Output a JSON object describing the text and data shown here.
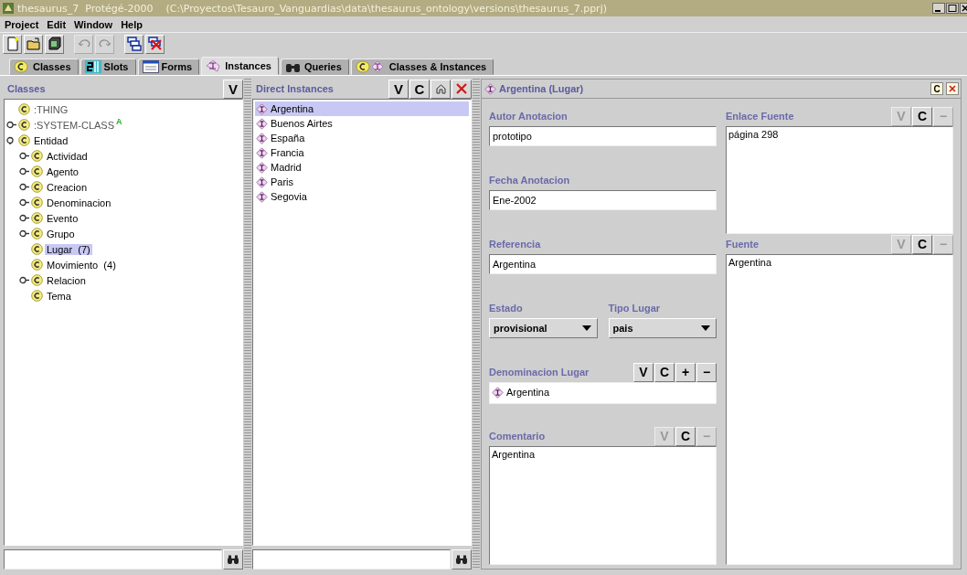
{
  "window": {
    "title": "thesaurus_7  Protégé-2000    (C:\\Proyectos\\Tesauro_Vanguardias\\data\\thesaurus_ontology\\versions\\thesaurus_7.pprj)"
  },
  "menu": [
    "Project",
    "Edit",
    "Window",
    "Help"
  ],
  "toolbar": [
    {
      "disabled": false
    },
    {
      "disabled": false
    },
    {
      "disabled": false
    },
    {
      "disabled": true
    },
    {
      "disabled": true
    },
    {
      "disabled": false
    },
    {
      "disabled": false
    }
  ],
  "tabs": [
    {
      "label": "Classes",
      "selected": false
    },
    {
      "label": "Slots",
      "selected": false
    },
    {
      "label": "Forms",
      "selected": false
    },
    {
      "label": "Instances",
      "selected": true
    },
    {
      "label": "Queries",
      "selected": false
    },
    {
      "label": "Classes & Instances",
      "selected": false
    }
  ],
  "classes": {
    "title": "Classes",
    "buttons": [
      "V"
    ],
    "tree": [
      {
        "label": ":THING",
        "kind": "leaf",
        "system": true,
        "selected": false
      },
      {
        "label": ":SYSTEM-CLASS",
        "kind": "branch",
        "expanded": false,
        "system": true,
        "badge": "A",
        "selected": false
      },
      {
        "label": "Entidad",
        "kind": "branch",
        "expanded": true,
        "system": false,
        "selected": false,
        "children": [
          {
            "label": "Actividad",
            "kind": "branch",
            "expanded": false,
            "system": false,
            "selected": false
          },
          {
            "label": "Agento",
            "kind": "branch",
            "expanded": false,
            "system": false,
            "selected": false
          },
          {
            "label": "Creacion",
            "kind": "branch",
            "expanded": false,
            "system": false,
            "selected": false
          },
          {
            "label": "Denominacion",
            "kind": "branch",
            "expanded": false,
            "system": false,
            "selected": false
          },
          {
            "label": "Evento",
            "kind": "branch",
            "expanded": false,
            "system": false,
            "selected": false
          },
          {
            "label": "Grupo",
            "kind": "branch",
            "expanded": false,
            "system": false,
            "selected": false
          },
          {
            "label": "Lugar",
            "count": "(7)",
            "kind": "leaf",
            "system": false,
            "selected": true
          },
          {
            "label": "Movimiento",
            "count": "(4)",
            "kind": "leaf",
            "system": false,
            "selected": false
          },
          {
            "label": "Relacion",
            "kind": "branch",
            "expanded": false,
            "system": false,
            "selected": false
          },
          {
            "label": "Tema",
            "kind": "leaf",
            "system": false,
            "selected": false
          }
        ]
      }
    ]
  },
  "instances": {
    "title": "Direct Instances",
    "buttons": [
      "V",
      "C"
    ],
    "items": [
      {
        "label": "Argentina",
        "selected": true
      },
      {
        "label": "Buenos Airtes",
        "selected": false
      },
      {
        "label": "España",
        "selected": false
      },
      {
        "label": "Francia",
        "selected": false
      },
      {
        "label": "Madrid",
        "selected": false
      },
      {
        "label": "Paris",
        "selected": false
      },
      {
        "label": "Segovia",
        "selected": false
      }
    ]
  },
  "form": {
    "title": "Argentina (Lugar)",
    "header_button": "C",
    "left": [
      {
        "kind": "text",
        "label": "Autor Anotacion",
        "value": "prototipo"
      },
      {
        "kind": "text",
        "label": "Fecha Anotacion",
        "value": "Ene-2002"
      },
      {
        "kind": "text",
        "label": "Referencia",
        "value": "Argentina"
      },
      {
        "kind": "dropdowns",
        "items": [
          {
            "label": "Estado",
            "value": "provisional"
          },
          {
            "label": "Tipo Lugar",
            "value": "pais"
          }
        ]
      },
      {
        "kind": "list",
        "label": "Denominacion Lugar",
        "buttons": [
          {
            "label": "V",
            "disabled": false
          },
          {
            "label": "C",
            "disabled": false
          },
          {
            "label": "+",
            "disabled": false
          },
          {
            "label": "−",
            "disabled": false
          }
        ],
        "values": [
          "Argentina"
        ]
      },
      {
        "kind": "area",
        "label": "Comentario",
        "buttons": [
          {
            "label": "V",
            "disabled": true
          },
          {
            "label": "C",
            "disabled": false
          },
          {
            "label": "−",
            "disabled": true
          }
        ],
        "value": "Argentina"
      }
    ],
    "right": [
      {
        "kind": "area",
        "label": "Enlace Fuente",
        "buttons": [
          {
            "label": "V",
            "disabled": true
          },
          {
            "label": "C",
            "disabled": false
          },
          {
            "label": "−",
            "disabled": true
          }
        ],
        "value": "página 298"
      },
      {
        "kind": "area",
        "label": "Fuente",
        "buttons": [
          {
            "label": "V",
            "disabled": true
          },
          {
            "label": "C",
            "disabled": false
          },
          {
            "label": "−",
            "disabled": true
          }
        ],
        "value": "Argentina"
      }
    ]
  }
}
